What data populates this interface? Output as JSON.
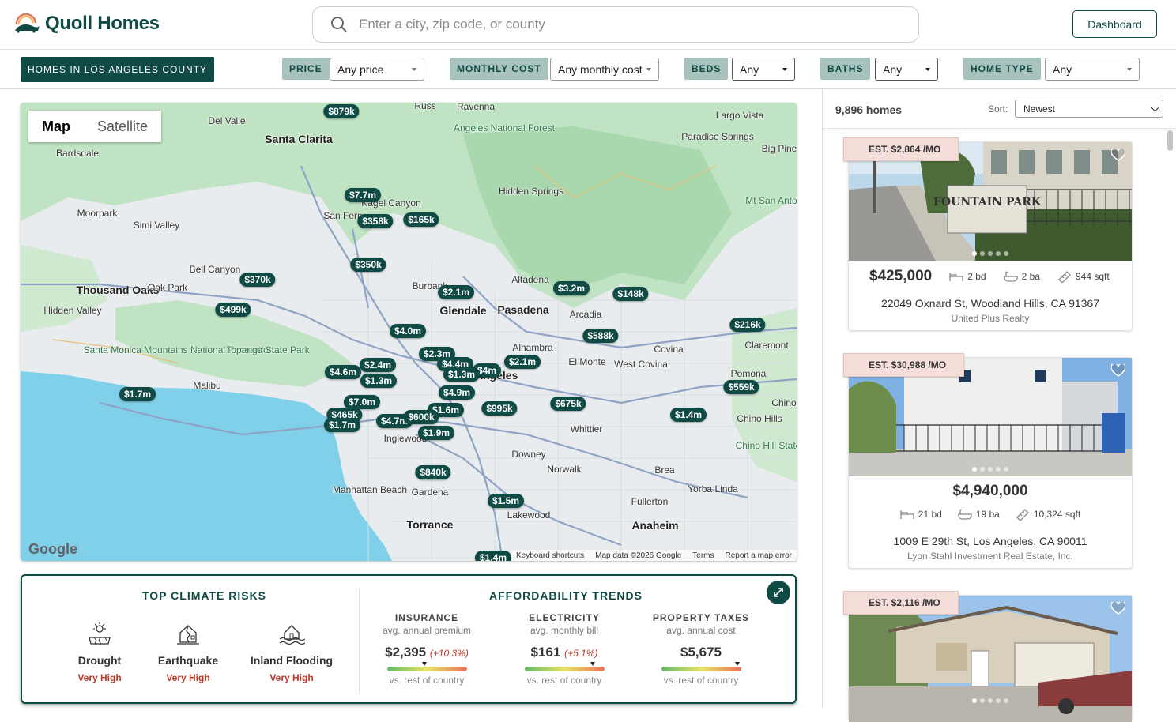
{
  "app": {
    "name": "Quoll Homes"
  },
  "header": {
    "search_placeholder": "Enter a city, zip code, or county",
    "dashboard_label": "Dashboard"
  },
  "filters": {
    "area": "HOMES IN LOS ANGELES COUNTY",
    "price_label": "PRICE",
    "price_value": "Any price",
    "monthly_label": "MONTHLY COST",
    "monthly_value": "Any monthly cost",
    "beds_label": "BEDS",
    "beds_value": "Any",
    "baths_label": "BATHS",
    "baths_value": "Any",
    "type_label": "HOME TYPE",
    "type_value": "Any"
  },
  "map": {
    "map_tab": "Map",
    "satellite_tab": "Satellite",
    "google_logo": "Google",
    "footer": [
      "Keyboard shortcuts",
      "Map data ©2026 Google",
      "Terms",
      "Report a map error"
    ],
    "pins": [
      "$879k",
      "$7.7m",
      "$358k",
      "$165k",
      "$350k",
      "$370k",
      "$499k",
      "$2.1m",
      "$3.2m",
      "$148k",
      "$4.0m",
      "$588k",
      "$216k",
      "$2.3m",
      "$4.6m",
      "$2.4m",
      "$4.4m",
      "$4m",
      "$2.1m",
      "$1.3m",
      "$1.3m",
      "$4.9m",
      "$559k",
      "$1.7m",
      "$7.0m",
      "$1.6m",
      "$995k",
      "$675k",
      "$1.4m",
      "$465k",
      "$4.7m",
      "$600k",
      "$1.7m",
      "$1.9m",
      "$840k",
      "$1.5m",
      "$1.4m"
    ],
    "places": [
      "Santa Clarita",
      "Del Valle",
      "Bardsdale",
      "Angeles National Forest",
      "Ravenna",
      "Russ",
      "Largo Vista",
      "Paradise Springs",
      "Hidden Springs",
      "Kagel Canyon",
      "San Fern",
      "Moorpark",
      "Simi Valley",
      "Bell Canyon",
      "Thousand Oaks",
      "Oak Park",
      "Hidden Valley",
      "Santa Monica Mountains National Recreation...",
      "Topanga State Park",
      "Malibu",
      "Burbank",
      "Glendale",
      "Pasadena",
      "Altadena",
      "Arcadia",
      "Alhambra",
      "El Monte",
      "West Covina",
      "Covina",
      "Claremont",
      "Pomona",
      "Chino",
      "Chino Hills",
      "Chino Hill State Par",
      "Los Angeles",
      "Whittier",
      "Downey",
      "Norwalk",
      "Brea",
      "Yorba Linda",
      "Fullerton",
      "Anaheim",
      "Inglewood",
      "Manhattan Beach",
      "Gardena",
      "Torrance",
      "Lakewood",
      "Mt San Antonio",
      "Big Pine"
    ]
  },
  "climate": {
    "title": "TOP CLIMATE RISKS",
    "risks": [
      {
        "name": "Drought",
        "level": "Very High"
      },
      {
        "name": "Earthquake",
        "level": "Very High"
      },
      {
        "name": "Inland Flooding",
        "level": "Very High"
      }
    ]
  },
  "afford": {
    "title": "AFFORDABILITY TRENDS",
    "items": [
      {
        "name": "INSURANCE",
        "sub": "avg. annual premium",
        "value": "$2,395",
        "change": "(+10.3%)",
        "compare": "vs. rest of country",
        "position": 0.47
      },
      {
        "name": "ELECTRICITY",
        "sub": "avg. monthly bill",
        "value": "$161",
        "change": "(+5.1%)",
        "compare": "vs. rest of country",
        "position": 0.86
      },
      {
        "name": "PROPERTY TAXES",
        "sub": "avg. annual cost",
        "value": "$5,675",
        "change": "",
        "compare": "vs. rest of country",
        "position": 0.96
      }
    ]
  },
  "listings": {
    "count": "9,896 homes",
    "sort_label": "Sort:",
    "sort_value": "Newest",
    "items": [
      {
        "est": "EST. $2,864 /MO",
        "price": "$425,000",
        "beds": "2 bd",
        "baths": "2 ba",
        "sqft": "944 sqft",
        "address": "22049 Oxnard St, Woodland Hills, CA 91367",
        "broker": "United Plus Realty",
        "photo_sign": "FOUNTAIN PARK"
      },
      {
        "est": "EST. $30,988 /MO",
        "price": "$4,940,000",
        "beds": "21 bd",
        "baths": "19 ba",
        "sqft": "10,324 sqft",
        "address": "1009 E 29th St, Los Angeles, CA 90011",
        "broker": "Lyon Stahl Investment Real Estate, Inc."
      },
      {
        "est": "EST. $2,116 /MO"
      }
    ]
  },
  "colors": {
    "brand": "#0f4a44",
    "risk": "#c0392b",
    "tag_bg": "#a8c2bd"
  }
}
